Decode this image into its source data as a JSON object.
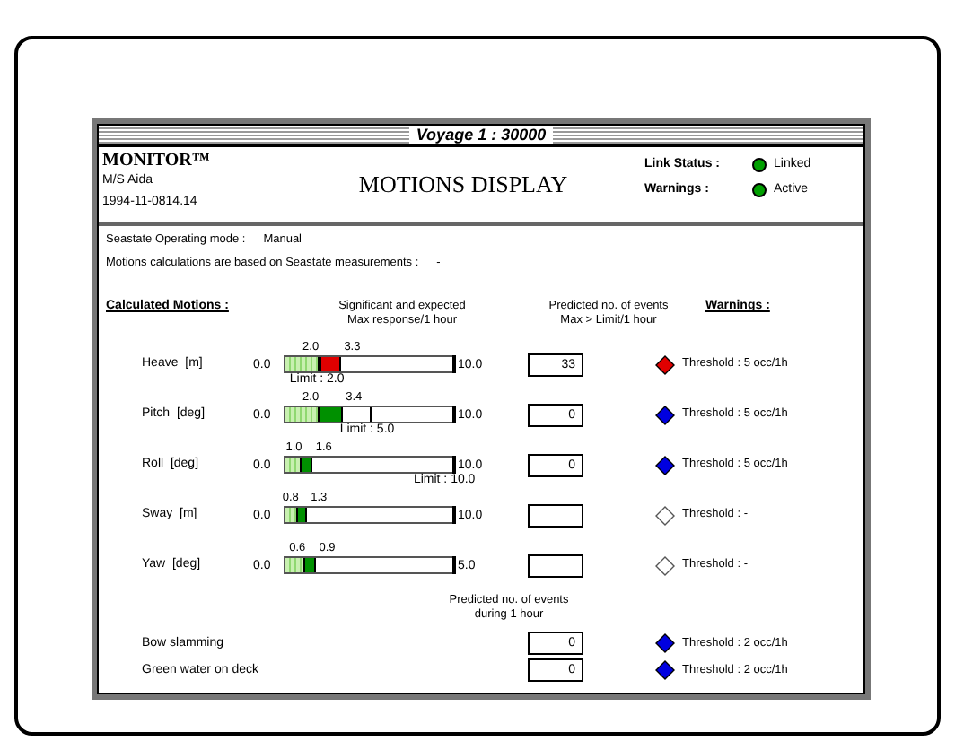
{
  "window": {
    "title": "Voyage 1 : 30000"
  },
  "header": {
    "app": "MONITOR™",
    "vessel": "M/S Aida",
    "timestamp": "1994-11-0814.14",
    "title": "MOTIONS DISPLAY",
    "status": [
      {
        "label": "Link Status :",
        "value": "Linked",
        "color": "#00a000"
      },
      {
        "label": "Warnings :",
        "value": "Active",
        "color": "#00a000"
      }
    ]
  },
  "info": [
    {
      "label": "Seastate Operating mode :",
      "value": "Manual"
    },
    {
      "label": "Motions calculations are based on Seastate measurements :",
      "value": "-"
    }
  ],
  "columns": {
    "motions": "Calculated Motions :",
    "response": [
      "Significant and expected",
      "Max response/1 hour"
    ],
    "events": [
      "Predicted no. of events",
      "Max > Limit/1 hour"
    ],
    "warnings": "Warnings :"
  },
  "motions": [
    {
      "name": "Heave  [m]",
      "min": "0.0",
      "max": "10.0",
      "sig": {
        "label": "2.0",
        "level": 0.2
      },
      "exp": {
        "label": "3.3",
        "level": 0.33,
        "color": "#e00000"
      },
      "limit": {
        "label": "Limit : 2.0",
        "level": 0.2
      },
      "events": "33",
      "warning": {
        "color": "#e00000",
        "text": "Threshold : 5 occ/1h"
      }
    },
    {
      "name": "Pitch  [deg]",
      "min": "0.0",
      "max": "10.0",
      "sig": {
        "label": "2.0",
        "level": 0.2
      },
      "exp": {
        "label": "3.4",
        "level": 0.34,
        "color": "#009000"
      },
      "limit": {
        "label": "Limit : 5.0",
        "level": 0.5
      },
      "events": "0",
      "warning": {
        "color": "#0000e0",
        "text": "Threshold : 5 occ/1h"
      }
    },
    {
      "name": "Roll  [deg]",
      "min": "0.0",
      "max": "10.0",
      "sig": {
        "label": "1.0",
        "level": 0.1
      },
      "exp": {
        "label": "1.6",
        "level": 0.16,
        "color": "#009000"
      },
      "limit": {
        "label": "Limit : 10.0",
        "level": 1
      },
      "events": "0",
      "warning": {
        "color": "#0000e0",
        "text": "Threshold : 5 occ/1h"
      }
    },
    {
      "name": "Sway  [m]",
      "min": "0.0",
      "max": "10.0",
      "sig": {
        "label": "0.8",
        "level": 0.08
      },
      "exp": {
        "label": "1.3",
        "level": 0.13,
        "color": "#009000"
      },
      "warning": {
        "text": "Threshold : -"
      }
    },
    {
      "name": "Yaw  [deg]",
      "min": "0.0",
      "max": "5.0",
      "sig": {
        "label": "0.6",
        "level": 0.12
      },
      "exp": {
        "label": "0.9",
        "level": 0.18,
        "color": "#009000"
      },
      "warning": {
        "text": "Threshold : -"
      }
    }
  ],
  "events_heading": [
    "Predicted no. of events",
    "during 1 hour"
  ],
  "events": [
    {
      "name": "Bow slamming",
      "value": "0",
      "warning": {
        "color": "#0000e0",
        "text": "Threshold : 2 occ/1h"
      }
    },
    {
      "name": "Green water on deck",
      "value": "0",
      "warning": {
        "color": "#0000e0",
        "text": "Threshold : 2 occ/1h"
      }
    }
  ]
}
